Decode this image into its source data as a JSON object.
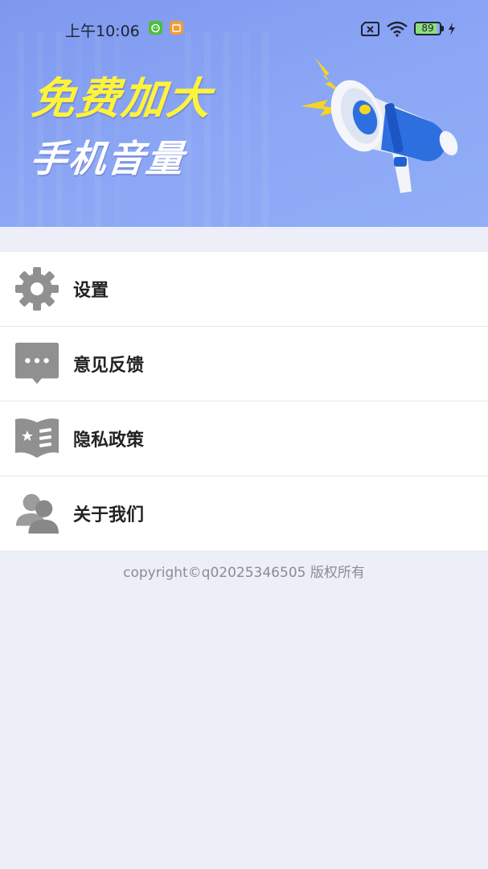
{
  "status_bar": {
    "time": "上午10:06",
    "battery_level": "89",
    "icons": [
      "android-app-icon",
      "calendar-app-icon",
      "no-sim-icon",
      "wifi-icon",
      "battery-icon",
      "charging-icon"
    ]
  },
  "banner": {
    "headline": "免费加大",
    "subline": "手机音量",
    "illustration": "megaphone-icon",
    "colors": {
      "background": "#8CA7F5",
      "headline": "#FFF33A",
      "subline": "#FFFFFF"
    }
  },
  "menu": {
    "items": [
      {
        "label": "设置",
        "icon": "gear-icon"
      },
      {
        "label": "意见反馈",
        "icon": "chat-bubble-icon"
      },
      {
        "label": "隐私政策",
        "icon": "policy-book-icon"
      },
      {
        "label": "关于我们",
        "icon": "users-icon"
      }
    ],
    "icon_color": "#909090"
  },
  "footer": {
    "copyright": "copyright©q02025346505 版权所有"
  }
}
